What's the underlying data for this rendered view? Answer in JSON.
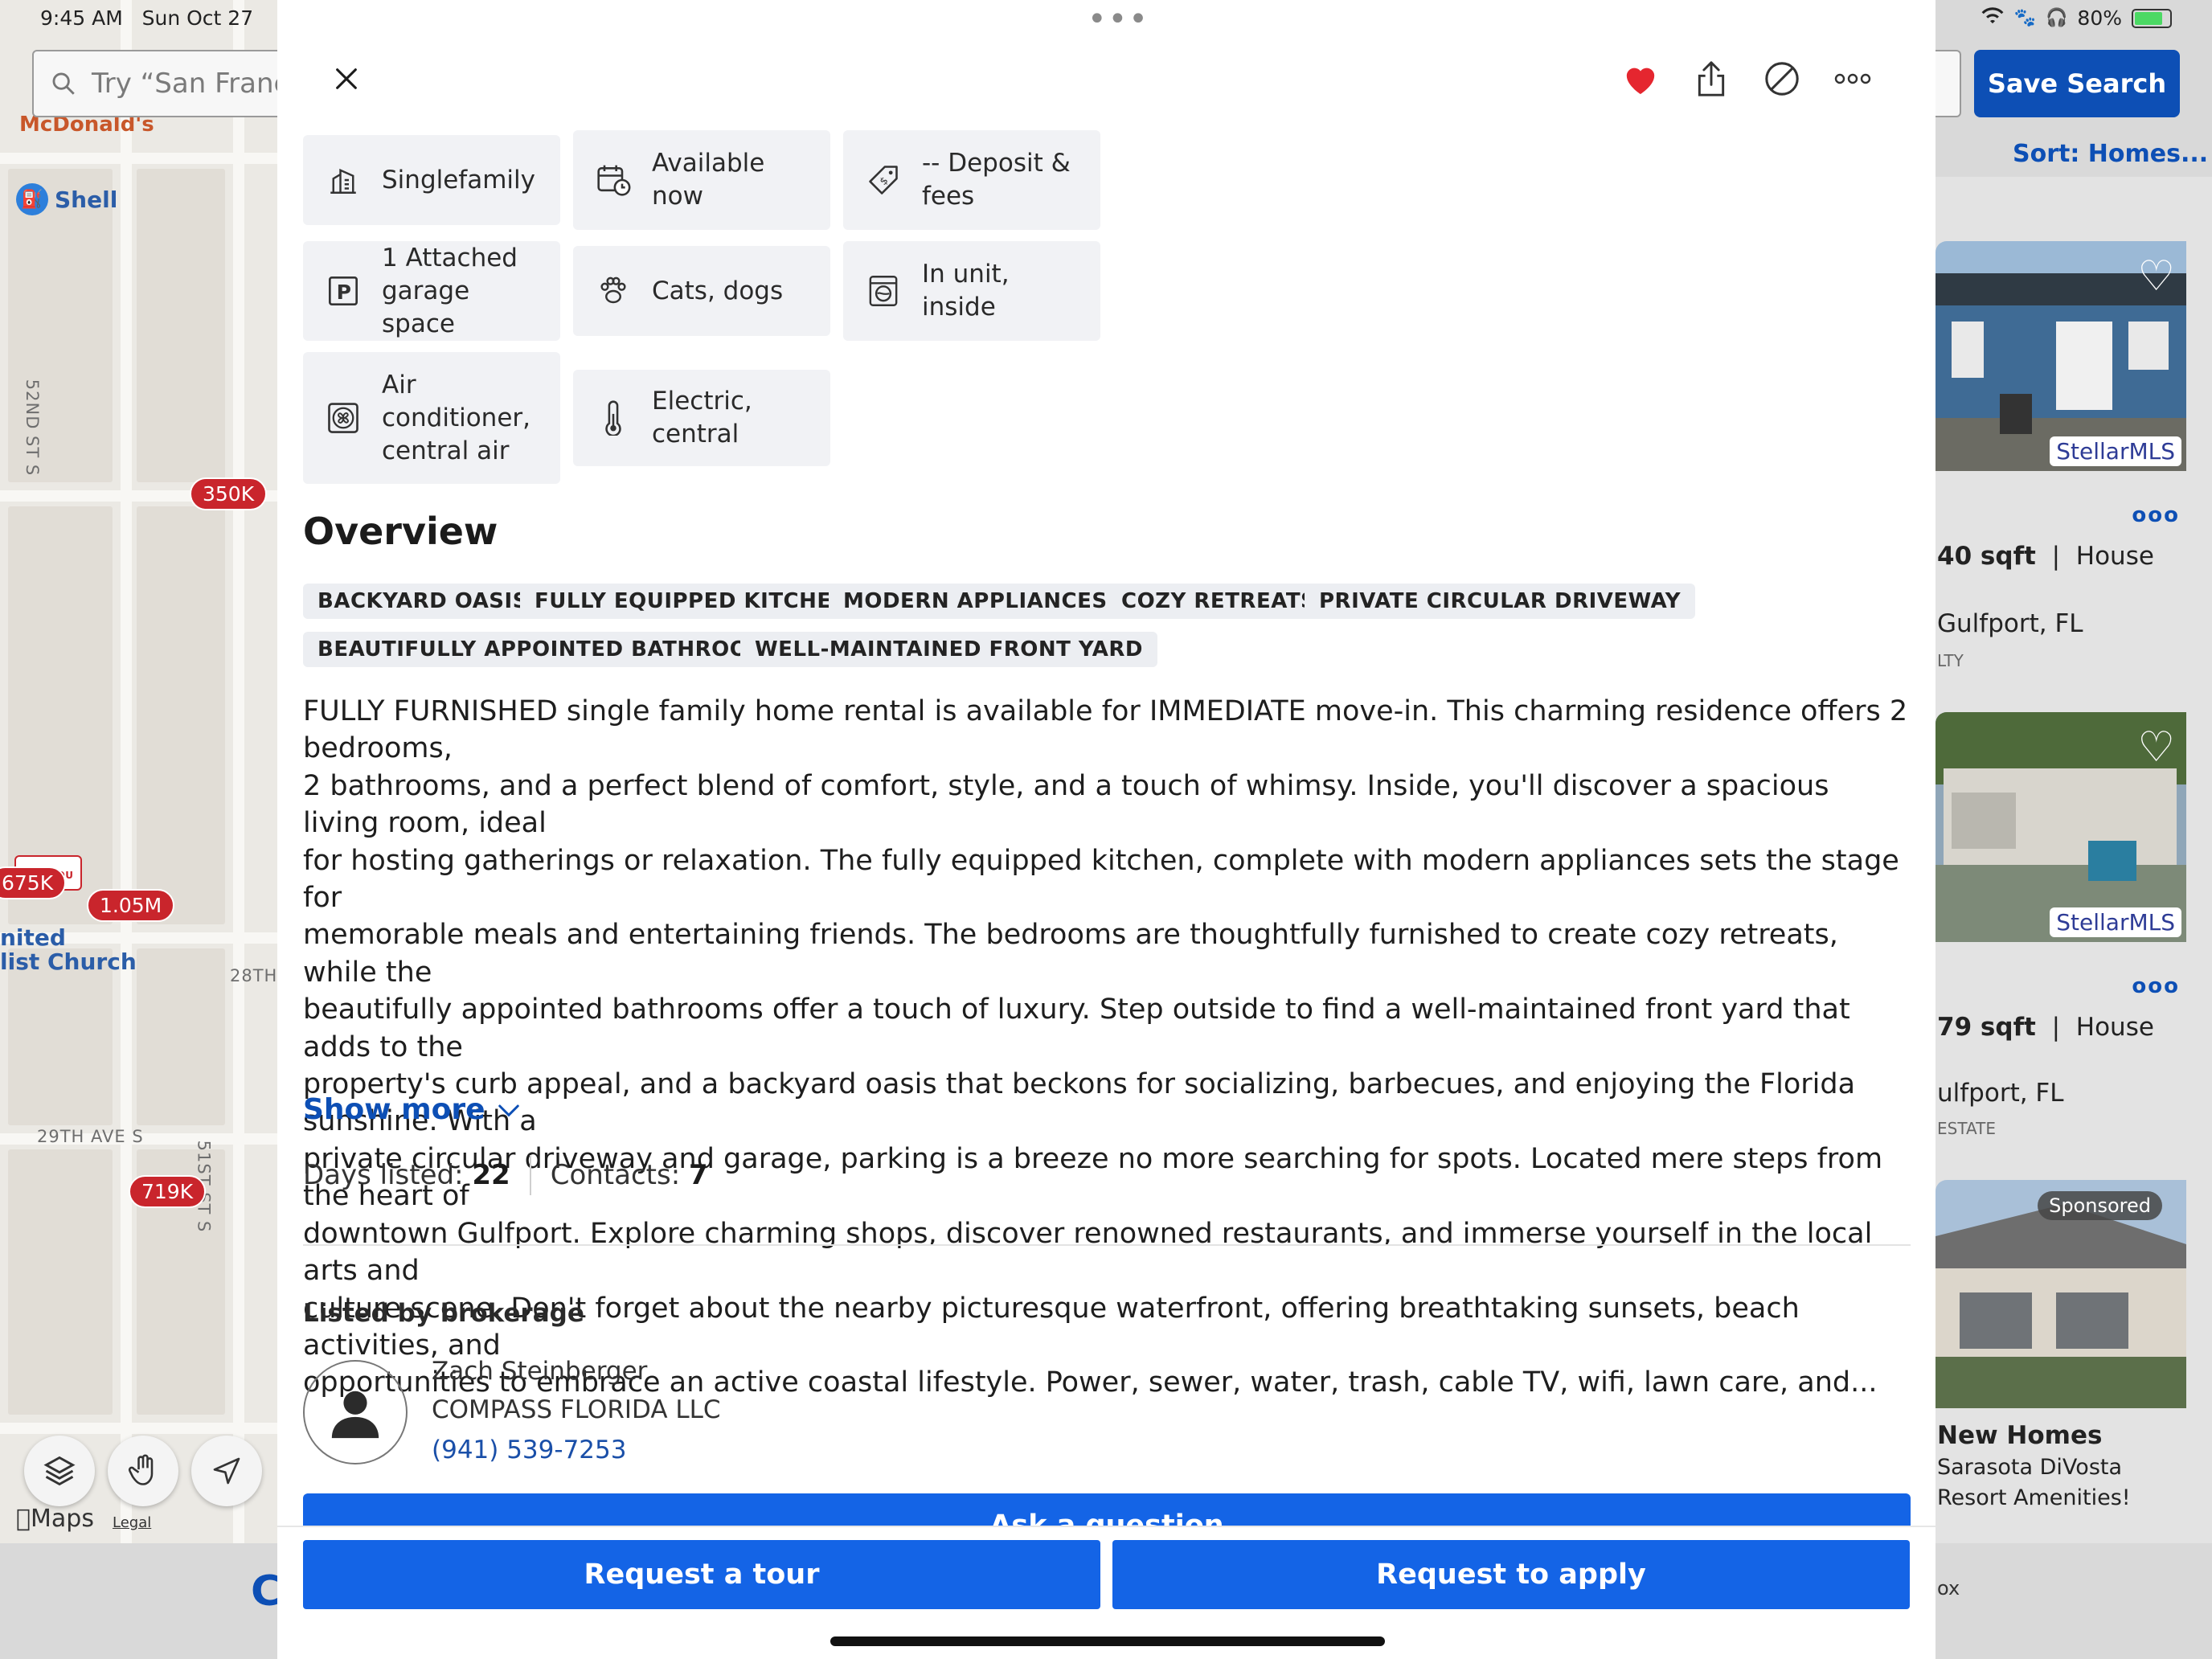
{
  "status_bar": {
    "time": "9:45 AM",
    "date": "Sun Oct 27",
    "battery": "80%"
  },
  "search": {
    "placeholder": "Try “San Francis",
    "save_label": "Save Search",
    "sort_label": "Sort: Homes..."
  },
  "map": {
    "shell_label": "Shell",
    "mcdonalds_label": "McDonald's",
    "street_labels": [
      "52ND ST S",
      "28TH",
      "29TH AVE S",
      "51ST ST S"
    ],
    "church_label_1": "nited",
    "church_label_2": "list Church",
    "pins": [
      "350K",
      "675K",
      "1.05M",
      "719K"
    ],
    "for_you_tag": "FOR YOU",
    "maps_brand": "Maps",
    "legal": "Legal"
  },
  "right_cards": [
    {
      "sqft": "40 sqft",
      "type": "House",
      "city": "Gulfport, FL",
      "broker": "LTY",
      "badge": "StellarMLS"
    },
    {
      "sqft": "79 sqft",
      "type": "House",
      "city": "ulfport, FL",
      "broker": "ESTATE",
      "badge": "StellarMLS"
    },
    {
      "sponsored": "Sponsored",
      "title": "New Homes",
      "line1": "Sarasota DiVosta",
      "line2": "Resort Amenities!"
    }
  ],
  "bottom_strip": {
    "left_char": "C",
    "right_text": "ox"
  },
  "sheet": {
    "grabber": "•••",
    "more_label": "•••",
    "facts": [
      {
        "icon": "building-icon",
        "text": "Singlefamily"
      },
      {
        "icon": "calendar-clock-icon",
        "text": "Available now"
      },
      {
        "icon": "price-tag-icon",
        "text": "-- Deposit & fees"
      },
      {
        "icon": "parking-icon",
        "text": "1 Attached garage space"
      },
      {
        "icon": "paw-icon",
        "text": "Cats, dogs"
      },
      {
        "icon": "washer-icon",
        "text": "In unit, inside"
      },
      {
        "icon": "fan-icon",
        "text": "Air conditioner, central air"
      },
      {
        "icon": "thermometer-icon",
        "text": "Electric, central"
      }
    ],
    "overview_title": "Overview",
    "tags": [
      "BACKYARD OASIS",
      "FULLY EQUIPPED KITCHEN",
      "MODERN APPLIANCES",
      "COZY RETREATS",
      "PRIVATE CIRCULAR DRIVEWAY",
      "BEAUTIFULLY APPOINTED BATHROOMS",
      "WELL-MAINTAINED FRONT YARD"
    ],
    "description_lines": [
      "FULLY FURNISHED single family home rental is available for IMMEDIATE move-in. This charming residence offers 2 bedrooms,",
      "2 bathrooms, and a perfect blend of comfort, style, and a touch of whimsy. Inside, you'll discover a spacious living room, ideal",
      "for hosting gatherings or relaxation. The fully equipped kitchen, complete with modern appliances sets the stage for",
      "memorable meals and entertaining friends. The bedrooms are thoughtfully furnished to create cozy retreats, while the",
      "beautifully appointed bathrooms offer a touch of luxury. Step outside to find a well-maintained front yard that adds to the",
      "property's curb appeal, and a backyard oasis that beckons for socializing, barbecues, and enjoying the Florida sunshine. With a",
      "private circular driveway and garage, parking is a breeze no more searching for spots. Located mere steps from the heart of",
      "downtown Gulfport. Explore charming shops, discover renowned restaurants, and immerse yourself in the local arts and",
      "culture scene. Don't forget about the nearby picturesque waterfront, offering breathtaking sunsets, beach activities, and",
      "opportunities to embrace an active coastal lifestyle. Power, sewer, water, trash, cable TV, wifi, lawn care, and..."
    ],
    "show_more": "Show more",
    "days_listed_label": "Days listed:",
    "days_listed_value": "22",
    "contacts_label": "Contacts:",
    "contacts_value": "7",
    "listed_by_label": "Listed by brokerage",
    "agent": {
      "name": "Zach Steinberger",
      "firm": "COMPASS FLORIDA LLC",
      "phone": "(941) 539-7253"
    },
    "ask_question": "Ask a question",
    "request_tour": "Request a tour",
    "request_apply": "Request to apply"
  },
  "colors": {
    "brand_blue": "#1464e6",
    "link_blue": "#0d4fb5",
    "heart_red": "#e5262f",
    "pin_red": "#c9252c"
  }
}
